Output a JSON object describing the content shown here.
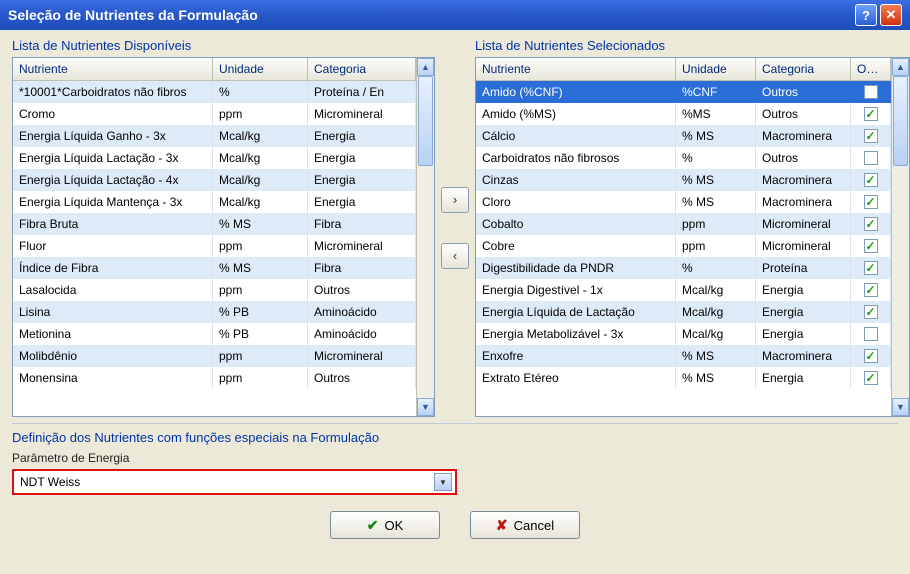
{
  "window": {
    "title": "Seleção de Nutrientes da Formulação"
  },
  "available": {
    "label": "Lista de Nutrientes Disponíveis",
    "headers": {
      "c0": "Nutriente",
      "c1": "Unidade",
      "c2": "Categoria"
    },
    "rows": [
      {
        "c0": "*10001*Carboidratos não fibros",
        "c1": "%",
        "c2": "Proteína / En"
      },
      {
        "c0": "Cromo",
        "c1": "ppm",
        "c2": "Micromineral"
      },
      {
        "c0": "Energia Líquida Ganho - 3x",
        "c1": "Mcal/kg",
        "c2": "Energia"
      },
      {
        "c0": "Energia Líquida Lactação - 3x",
        "c1": "Mcal/kg",
        "c2": "Energia"
      },
      {
        "c0": "Energia Líquida Lactação - 4x",
        "c1": "Mcal/kg",
        "c2": "Energia"
      },
      {
        "c0": "Energia Líquida Mantença - 3x",
        "c1": "Mcal/kg",
        "c2": "Energia"
      },
      {
        "c0": "Fibra Bruta",
        "c1": "% MS",
        "c2": "Fibra"
      },
      {
        "c0": "Fluor",
        "c1": "ppm",
        "c2": "Micromineral"
      },
      {
        "c0": "Índice de Fibra",
        "c1": "% MS",
        "c2": "Fibra"
      },
      {
        "c0": "Lasalocida",
        "c1": "ppm",
        "c2": "Outros"
      },
      {
        "c0": "Lisina",
        "c1": "% PB",
        "c2": "Aminoácido"
      },
      {
        "c0": "Metionina",
        "c1": "% PB",
        "c2": "Aminoácido"
      },
      {
        "c0": "Molibdênio",
        "c1": "ppm",
        "c2": "Micromineral"
      },
      {
        "c0": "Monensina",
        "c1": "ppm",
        "c2": "Outros"
      }
    ]
  },
  "selected": {
    "label": "Lista de Nutrientes Selecionados",
    "headers": {
      "c0": "Nutriente",
      "c1": "Unidade",
      "c2": "Categoria",
      "c3": "Obrig"
    },
    "rows": [
      {
        "c0": "Amido (%CNF)",
        "c1": "%CNF",
        "c2": "Outros",
        "chk": false,
        "sel": true
      },
      {
        "c0": "Amido (%MS)",
        "c1": "%MS",
        "c2": "Outros",
        "chk": true
      },
      {
        "c0": "Cálcio",
        "c1": "% MS",
        "c2": "Macrominera",
        "chk": true
      },
      {
        "c0": "Carboidratos não fibrosos",
        "c1": "%",
        "c2": "Outros",
        "chk": false
      },
      {
        "c0": "Cinzas",
        "c1": "% MS",
        "c2": "Macrominera",
        "chk": true
      },
      {
        "c0": "Cloro",
        "c1": "% MS",
        "c2": "Macrominera",
        "chk": true
      },
      {
        "c0": "Cobalto",
        "c1": "ppm",
        "c2": "Micromineral",
        "chk": true
      },
      {
        "c0": "Cobre",
        "c1": "ppm",
        "c2": "Micromineral",
        "chk": true
      },
      {
        "c0": "Digestibilidade da PNDR",
        "c1": "%",
        "c2": "Proteína",
        "chk": true
      },
      {
        "c0": "Energia Digestível - 1x",
        "c1": "Mcal/kg",
        "c2": "Energia",
        "chk": true
      },
      {
        "c0": "Energia Líquida de Lactação",
        "c1": "Mcal/kg",
        "c2": "Energia",
        "chk": true
      },
      {
        "c0": "Energia Metabolizável - 3x",
        "c1": "Mcal/kg",
        "c2": "Energia",
        "chk": false
      },
      {
        "c0": "Enxofre",
        "c1": "% MS",
        "c2": "Macrominera",
        "chk": true
      },
      {
        "c0": "Extrato Etéreo",
        "c1": "% MS",
        "c2": "Energia",
        "chk": true
      }
    ]
  },
  "special": {
    "title": "Definição dos Nutrientes com funções especiais na Formulação",
    "param_label": "Parâmetro de Energia",
    "param_value": "NDT Weiss"
  },
  "buttons": {
    "ok": "OK",
    "cancel": "Cancel"
  }
}
